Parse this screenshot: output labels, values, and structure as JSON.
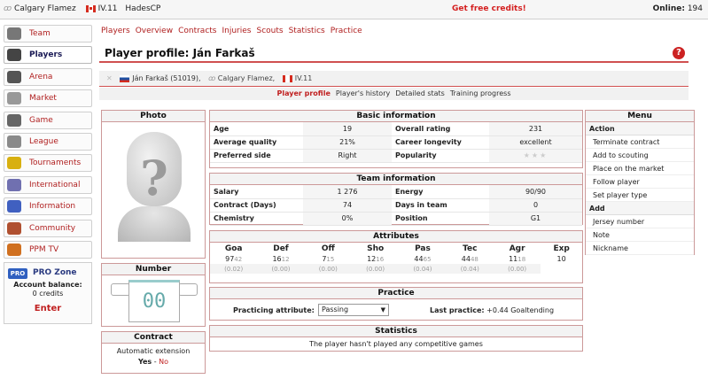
{
  "topbar": {
    "club": "Calgary Flamez",
    "league": "IV.11",
    "manager": "HadesCP",
    "credits_link": "Get free credits!",
    "online_label": "Online:",
    "online_count": "194"
  },
  "sidebar": {
    "items": [
      {
        "label": "Team",
        "icon": "helmet-icon",
        "color": "#777777"
      },
      {
        "label": "Players",
        "icon": "player-icon",
        "color": "#444444"
      },
      {
        "label": "Arena",
        "icon": "puck-icon",
        "color": "#555555"
      },
      {
        "label": "Market",
        "icon": "tag-icon",
        "color": "#999999"
      },
      {
        "label": "Game",
        "icon": "skaters-icon",
        "color": "#666666"
      },
      {
        "label": "League",
        "icon": "podium-icon",
        "color": "#8a8a8a"
      },
      {
        "label": "Tournaments",
        "icon": "trophy-icon",
        "color": "#d8b010"
      },
      {
        "label": "International",
        "icon": "flags-icon",
        "color": "#7070b0"
      },
      {
        "label": "Information",
        "icon": "info-icon",
        "color": "#4060c0"
      },
      {
        "label": "Community",
        "icon": "people-icon",
        "color": "#b05030"
      },
      {
        "label": "PPM TV",
        "icon": "tv-icon",
        "color": "#d07020"
      }
    ],
    "pro": {
      "badge": "PRO",
      "title": "PRO Zone",
      "balance_label": "Account balance:",
      "balance": "0 credits",
      "enter": "Enter"
    }
  },
  "nav": [
    "Players",
    "Overview",
    "Contracts",
    "Injuries",
    "Scouts",
    "Statistics",
    "Practice"
  ],
  "page_title": "Player profile: Ján Farkaš",
  "help_label": "?",
  "player_info": {
    "name": "Ján Farkaš (51019),",
    "club": "Calgary Flamez,",
    "league": "IV.11"
  },
  "subtabs": [
    "Player profile",
    "Player's history",
    "Detailed stats",
    "Training progress"
  ],
  "photo": {
    "title": "Photo",
    "placeholder": "?"
  },
  "number": {
    "title": "Number",
    "jersey": "00"
  },
  "contract": {
    "title": "Contract",
    "text": "Automatic extension",
    "yes": "Yes",
    "sep": "-",
    "no": "No"
  },
  "basic": {
    "title": "Basic information",
    "rows": [
      {
        "k1": "Age",
        "v1": "19",
        "k2": "Overall rating",
        "v2": "231"
      },
      {
        "k1": "Average quality",
        "v1": "21%",
        "k2": "Career longevity",
        "v2": "excellent"
      },
      {
        "k1": "Preferred side",
        "v1": "Right",
        "k2": "Popularity",
        "v2": ""
      }
    ],
    "popularity_stars": 0
  },
  "team": {
    "title": "Team information",
    "rows": [
      {
        "k1": "Salary",
        "v1": "1 276",
        "k2": "Energy",
        "v2": "90/90"
      },
      {
        "k1": "Contract (Days)",
        "v1": "74",
        "k2": "Days in team",
        "v2": "0"
      },
      {
        "k1": "Chemistry",
        "v1": "0%",
        "k2": "Position",
        "v2": "G1"
      }
    ]
  },
  "attributes": {
    "title": "Attributes",
    "headers": [
      "Goa",
      "Def",
      "Off",
      "Sho",
      "Pas",
      "Tec",
      "Agr",
      "Exp"
    ],
    "values": [
      "97",
      "16",
      "7",
      "12",
      "44",
      "44",
      "11",
      "10"
    ],
    "potentials": [
      "42",
      "12",
      "15",
      "16",
      "65",
      "48",
      "18",
      ""
    ],
    "changes": [
      "(0.02)",
      "(0.00)",
      "(0.00)",
      "(0.00)",
      "(0.04)",
      "(0.04)",
      "(0.00)",
      ""
    ]
  },
  "practice": {
    "title": "Practice",
    "label": "Practicing attribute:",
    "selected": "Passing",
    "last_label": "Last practice:",
    "last_value": "+0.44 Goaltending"
  },
  "statistics": {
    "title": "Statistics",
    "text": "The player hasn't played any competitive games"
  },
  "menu": {
    "title": "Menu",
    "sections": [
      {
        "name": "Action",
        "items": [
          "Terminate contract",
          "Add to scouting",
          "Place on the market",
          "Follow player",
          "Set player type"
        ]
      },
      {
        "name": "Add",
        "items": [
          "Jersey number",
          "Note",
          "Nickname"
        ]
      }
    ]
  },
  "colors": {
    "accent": "#c02020",
    "nav": "#b02020",
    "panel_border": "#cc9999"
  }
}
